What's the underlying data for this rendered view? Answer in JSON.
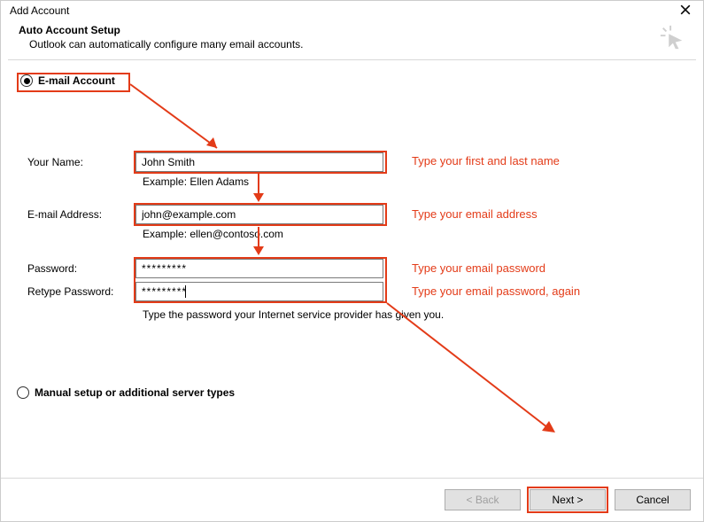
{
  "window": {
    "title": "Add Account"
  },
  "header": {
    "title": "Auto Account Setup",
    "subtitle": "Outlook can automatically configure many email accounts."
  },
  "radios": {
    "email": "E-mail Account",
    "manual": "Manual setup or additional server types"
  },
  "labels": {
    "name": "Your Name:",
    "email": "E-mail Address:",
    "password": "Password:",
    "retype": "Retype Password:"
  },
  "values": {
    "name": "John Smith",
    "email": "john@example.com",
    "password": "*********",
    "retype": "*********"
  },
  "examples": {
    "name": "Example: Ellen Adams",
    "email": "Example: ellen@contoso.com",
    "password_note": "Type the password your Internet service provider has given you."
  },
  "annotations": {
    "name": "Type your first and last name",
    "email": "Type your email address",
    "password": "Type your email password",
    "retype": "Type your email password, again"
  },
  "buttons": {
    "back": "< Back",
    "next": "Next >",
    "cancel": "Cancel"
  },
  "colors": {
    "highlight": "#e33b18"
  }
}
